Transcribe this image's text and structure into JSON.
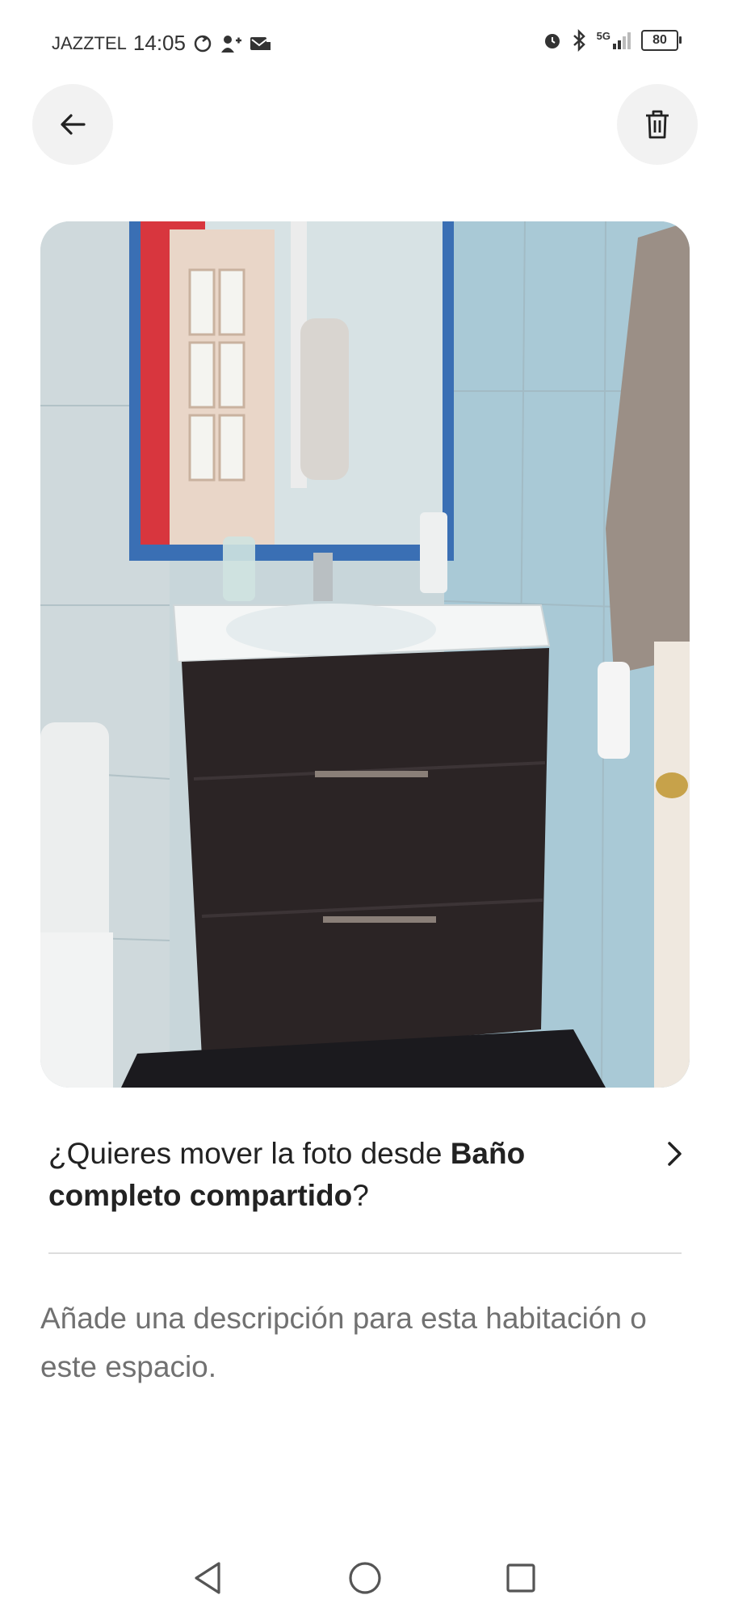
{
  "status_bar": {
    "carrier": "JAZZTEL",
    "time": "14:05",
    "network": "5G",
    "battery": "80"
  },
  "toolbar": {
    "back_icon": "arrow-left-icon",
    "delete_icon": "trash-icon"
  },
  "photo": {
    "subject": "bathroom-vanity-photo"
  },
  "move_prompt": {
    "prefix": "¿Quieres mover la foto desde ",
    "room_name": "Baño completo compartido",
    "suffix": "?"
  },
  "description": {
    "placeholder": "Añade una descripción para esta habitación o este espacio."
  },
  "nav_bar": {
    "back_icon": "triangle-back-icon",
    "home_icon": "circle-home-icon",
    "recent_icon": "square-recents-icon"
  }
}
